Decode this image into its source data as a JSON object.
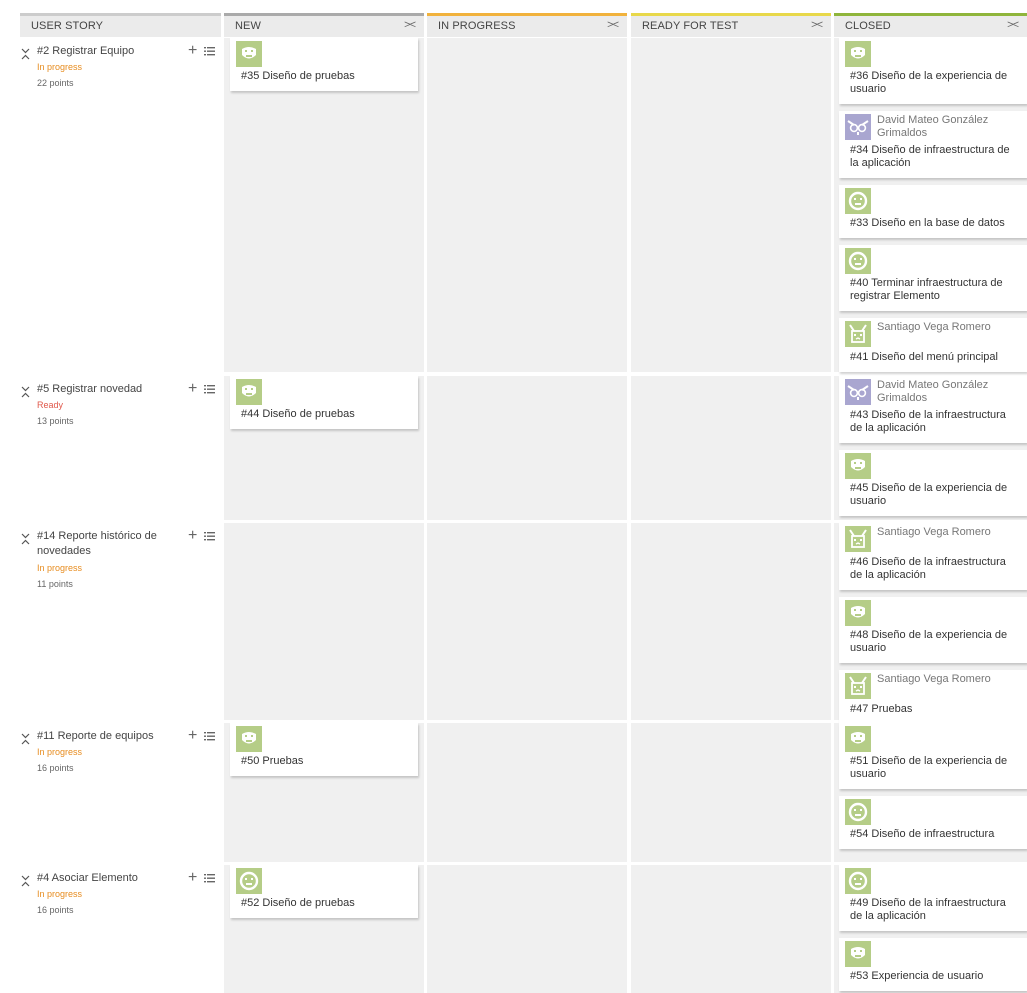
{
  "columns": [
    {
      "label": "USER STORY"
    },
    {
      "label": "NEW",
      "fold": "><"
    },
    {
      "label": "IN PROGRESS",
      "fold": "><"
    },
    {
      "label": "READY FOR TEST",
      "fold": "><"
    },
    {
      "label": "CLOSED",
      "fold": "><"
    }
  ],
  "colors": {
    "status_in_progress": "#e78c1f",
    "status_ready": "#e0584b",
    "header_new": "#aaaaaa",
    "header_in_progress": "#f1b23c",
    "header_ready": "#e8d84a",
    "header_closed": "#8fb53b",
    "avatar_green": "#b5cd87",
    "avatar_purple": "#a9a6d0"
  },
  "stories": [
    {
      "title": "#2 Registrar Equipo",
      "status": "In progress",
      "points": "22 points",
      "new": [
        {
          "title": "#35 Diseño de pruebas",
          "avatar": "smile"
        }
      ],
      "closed": [
        {
          "title": "#36 Diseño de la experiencia de usuario",
          "avatar": "smile"
        },
        {
          "title": "#34 Diseño de infraestructura de la aplicación",
          "avatar": "owl",
          "assignee": "David Mateo González Grimaldos"
        },
        {
          "title": "#33 Diseño en la base de datos",
          "avatar": "circle"
        },
        {
          "title": "#40 Terminar infraestructura de registrar Elemento",
          "avatar": "circle"
        },
        {
          "title": "#41 Diseño del menú principal",
          "avatar": "cat",
          "assignee": "Santiago Vega Romero"
        }
      ]
    },
    {
      "title": "#5 Registrar novedad",
      "status": "Ready",
      "points": "13 points",
      "new": [
        {
          "title": "#44 Diseño de pruebas",
          "avatar": "smile"
        }
      ],
      "closed": [
        {
          "title": "#43 Diseño de la infraestructura de la aplicación",
          "avatar": "owl",
          "assignee": "David Mateo González Grimaldos"
        },
        {
          "title": "#45 Diseño de la experiencia de usuario",
          "avatar": "smile"
        }
      ]
    },
    {
      "title": "#14 Reporte histórico de novedades",
      "status": "In progress",
      "points": "11 points",
      "new": [],
      "closed": [
        {
          "title": "#46 Diseño de la infraestructura de la aplicación",
          "avatar": "cat",
          "assignee": "Santiago Vega Romero"
        },
        {
          "title": "#48 Diseño de la experiencia de usuario",
          "avatar": "smile"
        },
        {
          "title": "#47 Pruebas",
          "avatar": "cat",
          "assignee": "Santiago Vega Romero"
        }
      ]
    },
    {
      "title": "#11 Reporte de equipos",
      "status": "In progress",
      "points": "16 points",
      "new": [
        {
          "title": "#50 Pruebas",
          "avatar": "smile"
        }
      ],
      "closed": [
        {
          "title": "#51 Diseño de la experiencia de usuario",
          "avatar": "smile"
        },
        {
          "title": "#54 Diseño de infraestructura",
          "avatar": "circle"
        }
      ]
    },
    {
      "title": "#4 Asociar Elemento",
      "status": "In progress",
      "points": "16 points",
      "new": [
        {
          "title": "#52 Diseño de pruebas",
          "avatar": "circle"
        }
      ],
      "closed": [
        {
          "title": "#49 Diseño de la infraestructura de la aplicación",
          "avatar": "circle"
        },
        {
          "title": "#53 Experiencia de usuario",
          "avatar": "smile"
        }
      ]
    }
  ]
}
